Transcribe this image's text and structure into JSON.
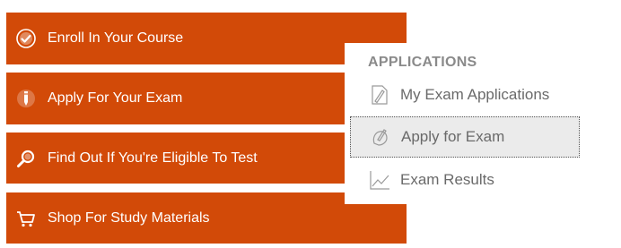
{
  "steps": [
    {
      "label": "Enroll In Your Course",
      "icon": "checkmark-circle-icon"
    },
    {
      "label": "Apply For Your Exam",
      "icon": "pencil-icon"
    },
    {
      "label": "Find Out If You're Eligible To Test",
      "icon": "magnifier-icon"
    },
    {
      "label": "Shop For Study Materials",
      "icon": "cart-icon"
    }
  ],
  "applications_menu": {
    "header": "APPLICATIONS",
    "items": [
      {
        "label": "My Exam Applications",
        "icon": "document-pencil-icon",
        "selected": false
      },
      {
        "label": "Apply for Exam",
        "icon": "hand-pencil-icon",
        "selected": true
      },
      {
        "label": "Exam Results",
        "icon": "line-chart-icon",
        "selected": false
      }
    ]
  },
  "colors": {
    "step_background": "#d24a08",
    "step_text": "#ffffff",
    "menu_header": "#8a8a8a",
    "menu_text": "#6a6a6a",
    "menu_selected_background": "#ebebeb"
  }
}
